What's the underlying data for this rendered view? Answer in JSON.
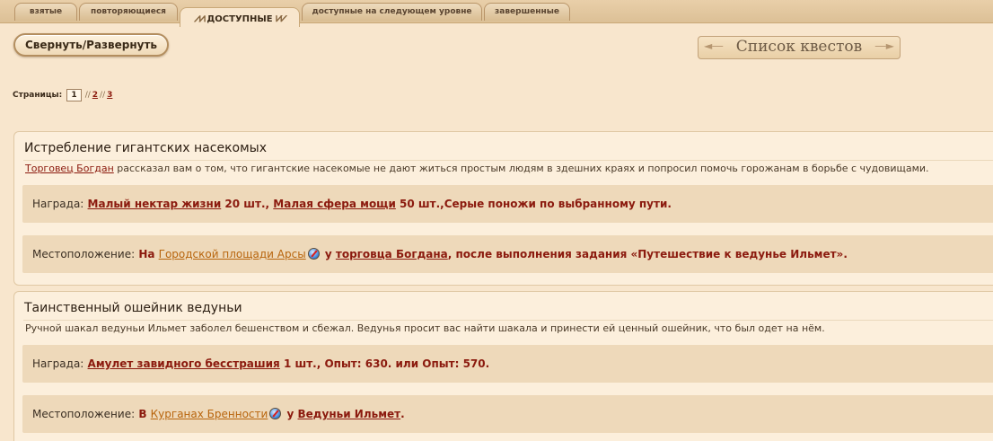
{
  "tabs": [
    {
      "label": "взятые",
      "active": false
    },
    {
      "label": "повторяющиеся",
      "active": false
    },
    {
      "label": "ДОСТУПНЫЕ",
      "active": true
    },
    {
      "label": "доступные на следующем уровне",
      "active": false
    },
    {
      "label": "завершенные",
      "active": false
    }
  ],
  "controls": {
    "collapse_label": "Свернуть/Развернуть",
    "page_title": "Список квестов"
  },
  "pager": {
    "label": "Страницы:",
    "current": "1",
    "sep": "//",
    "pages": [
      "2",
      "3"
    ]
  },
  "quests": [
    {
      "title": "Истребление гигантских насекомых",
      "desc_npc": "Торговец Богдан",
      "desc_rest": " рассказал вам о том, что гигантские насекомые не дают житься простым людям в здешних краях и попросил помочь горожанам в борьбе с чудовищами.",
      "reward_label": "Награда:",
      "reward_item1": "Малый нектар жизни",
      "reward_qty1": " 20 шт., ",
      "reward_item2": "Малая сфера мощи",
      "reward_qty2": " 50 шт.,Серые поножи по выбранному пути.",
      "location_label": "Местоположение:",
      "loc_prefix": " На ",
      "loc_place": "Городской площади Арсы",
      "loc_mid": " у ",
      "loc_npc": "торговца Богдана",
      "loc_suffix": ", после выполнения задания «Путешествие к ведунье Ильмет»."
    },
    {
      "title": "Таинственный ошейник ведуньи",
      "desc_rest": "Ручной шакал ведуньи Ильмет заболел бешенством и сбежал. Ведунья просит вас найти шакала и принести ей ценный ошейник, что был одет на нём.",
      "reward_label": "Награда:",
      "reward_item1": "Амулет завидного бесстрашия",
      "reward_qty1": " 1 шт., Опыт: 630. или Опыт: 570.",
      "location_label": "Местоположение:",
      "loc_prefix": " В ",
      "loc_place": "Курганах Бренности",
      "loc_mid": " у ",
      "loc_npc": "Ведуньи Ильмет",
      "loc_suffix": "."
    }
  ],
  "icons": {
    "compass": "compass-icon",
    "tab_deco": "crossed-swords-icon"
  },
  "colors": {
    "link": "#8b1a0e",
    "location_link": "#b8650d",
    "background": "#f8e6cd",
    "panel": "#eed9ba"
  }
}
